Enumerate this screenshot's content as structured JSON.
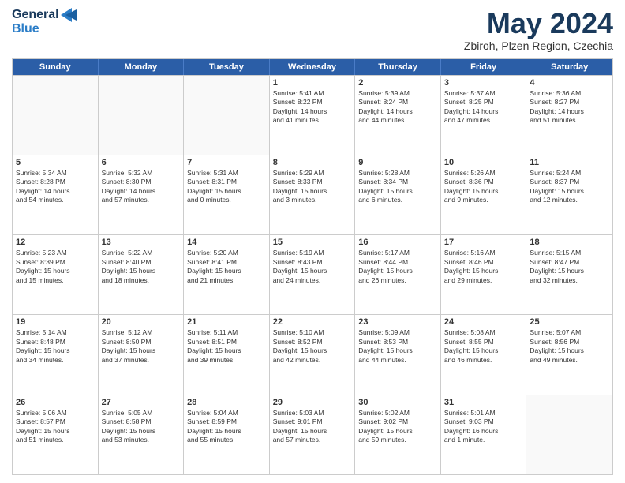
{
  "logo": {
    "line1": "General",
    "line2": "Blue"
  },
  "title": "May 2024",
  "location": "Zbiroh, Plzen Region, Czechia",
  "days_header": [
    "Sunday",
    "Monday",
    "Tuesday",
    "Wednesday",
    "Thursday",
    "Friday",
    "Saturday"
  ],
  "weeks": [
    [
      {
        "day": "",
        "data": ""
      },
      {
        "day": "",
        "data": ""
      },
      {
        "day": "",
        "data": ""
      },
      {
        "day": "1",
        "data": "Sunrise: 5:41 AM\nSunset: 8:22 PM\nDaylight: 14 hours\nand 41 minutes."
      },
      {
        "day": "2",
        "data": "Sunrise: 5:39 AM\nSunset: 8:24 PM\nDaylight: 14 hours\nand 44 minutes."
      },
      {
        "day": "3",
        "data": "Sunrise: 5:37 AM\nSunset: 8:25 PM\nDaylight: 14 hours\nand 47 minutes."
      },
      {
        "day": "4",
        "data": "Sunrise: 5:36 AM\nSunset: 8:27 PM\nDaylight: 14 hours\nand 51 minutes."
      }
    ],
    [
      {
        "day": "5",
        "data": "Sunrise: 5:34 AM\nSunset: 8:28 PM\nDaylight: 14 hours\nand 54 minutes."
      },
      {
        "day": "6",
        "data": "Sunrise: 5:32 AM\nSunset: 8:30 PM\nDaylight: 14 hours\nand 57 minutes."
      },
      {
        "day": "7",
        "data": "Sunrise: 5:31 AM\nSunset: 8:31 PM\nDaylight: 15 hours\nand 0 minutes."
      },
      {
        "day": "8",
        "data": "Sunrise: 5:29 AM\nSunset: 8:33 PM\nDaylight: 15 hours\nand 3 minutes."
      },
      {
        "day": "9",
        "data": "Sunrise: 5:28 AM\nSunset: 8:34 PM\nDaylight: 15 hours\nand 6 minutes."
      },
      {
        "day": "10",
        "data": "Sunrise: 5:26 AM\nSunset: 8:36 PM\nDaylight: 15 hours\nand 9 minutes."
      },
      {
        "day": "11",
        "data": "Sunrise: 5:24 AM\nSunset: 8:37 PM\nDaylight: 15 hours\nand 12 minutes."
      }
    ],
    [
      {
        "day": "12",
        "data": "Sunrise: 5:23 AM\nSunset: 8:39 PM\nDaylight: 15 hours\nand 15 minutes."
      },
      {
        "day": "13",
        "data": "Sunrise: 5:22 AM\nSunset: 8:40 PM\nDaylight: 15 hours\nand 18 minutes."
      },
      {
        "day": "14",
        "data": "Sunrise: 5:20 AM\nSunset: 8:41 PM\nDaylight: 15 hours\nand 21 minutes."
      },
      {
        "day": "15",
        "data": "Sunrise: 5:19 AM\nSunset: 8:43 PM\nDaylight: 15 hours\nand 24 minutes."
      },
      {
        "day": "16",
        "data": "Sunrise: 5:17 AM\nSunset: 8:44 PM\nDaylight: 15 hours\nand 26 minutes."
      },
      {
        "day": "17",
        "data": "Sunrise: 5:16 AM\nSunset: 8:46 PM\nDaylight: 15 hours\nand 29 minutes."
      },
      {
        "day": "18",
        "data": "Sunrise: 5:15 AM\nSunset: 8:47 PM\nDaylight: 15 hours\nand 32 minutes."
      }
    ],
    [
      {
        "day": "19",
        "data": "Sunrise: 5:14 AM\nSunset: 8:48 PM\nDaylight: 15 hours\nand 34 minutes."
      },
      {
        "day": "20",
        "data": "Sunrise: 5:12 AM\nSunset: 8:50 PM\nDaylight: 15 hours\nand 37 minutes."
      },
      {
        "day": "21",
        "data": "Sunrise: 5:11 AM\nSunset: 8:51 PM\nDaylight: 15 hours\nand 39 minutes."
      },
      {
        "day": "22",
        "data": "Sunrise: 5:10 AM\nSunset: 8:52 PM\nDaylight: 15 hours\nand 42 minutes."
      },
      {
        "day": "23",
        "data": "Sunrise: 5:09 AM\nSunset: 8:53 PM\nDaylight: 15 hours\nand 44 minutes."
      },
      {
        "day": "24",
        "data": "Sunrise: 5:08 AM\nSunset: 8:55 PM\nDaylight: 15 hours\nand 46 minutes."
      },
      {
        "day": "25",
        "data": "Sunrise: 5:07 AM\nSunset: 8:56 PM\nDaylight: 15 hours\nand 49 minutes."
      }
    ],
    [
      {
        "day": "26",
        "data": "Sunrise: 5:06 AM\nSunset: 8:57 PM\nDaylight: 15 hours\nand 51 minutes."
      },
      {
        "day": "27",
        "data": "Sunrise: 5:05 AM\nSunset: 8:58 PM\nDaylight: 15 hours\nand 53 minutes."
      },
      {
        "day": "28",
        "data": "Sunrise: 5:04 AM\nSunset: 8:59 PM\nDaylight: 15 hours\nand 55 minutes."
      },
      {
        "day": "29",
        "data": "Sunrise: 5:03 AM\nSunset: 9:01 PM\nDaylight: 15 hours\nand 57 minutes."
      },
      {
        "day": "30",
        "data": "Sunrise: 5:02 AM\nSunset: 9:02 PM\nDaylight: 15 hours\nand 59 minutes."
      },
      {
        "day": "31",
        "data": "Sunrise: 5:01 AM\nSunset: 9:03 PM\nDaylight: 16 hours\nand 1 minute."
      },
      {
        "day": "",
        "data": ""
      }
    ]
  ]
}
